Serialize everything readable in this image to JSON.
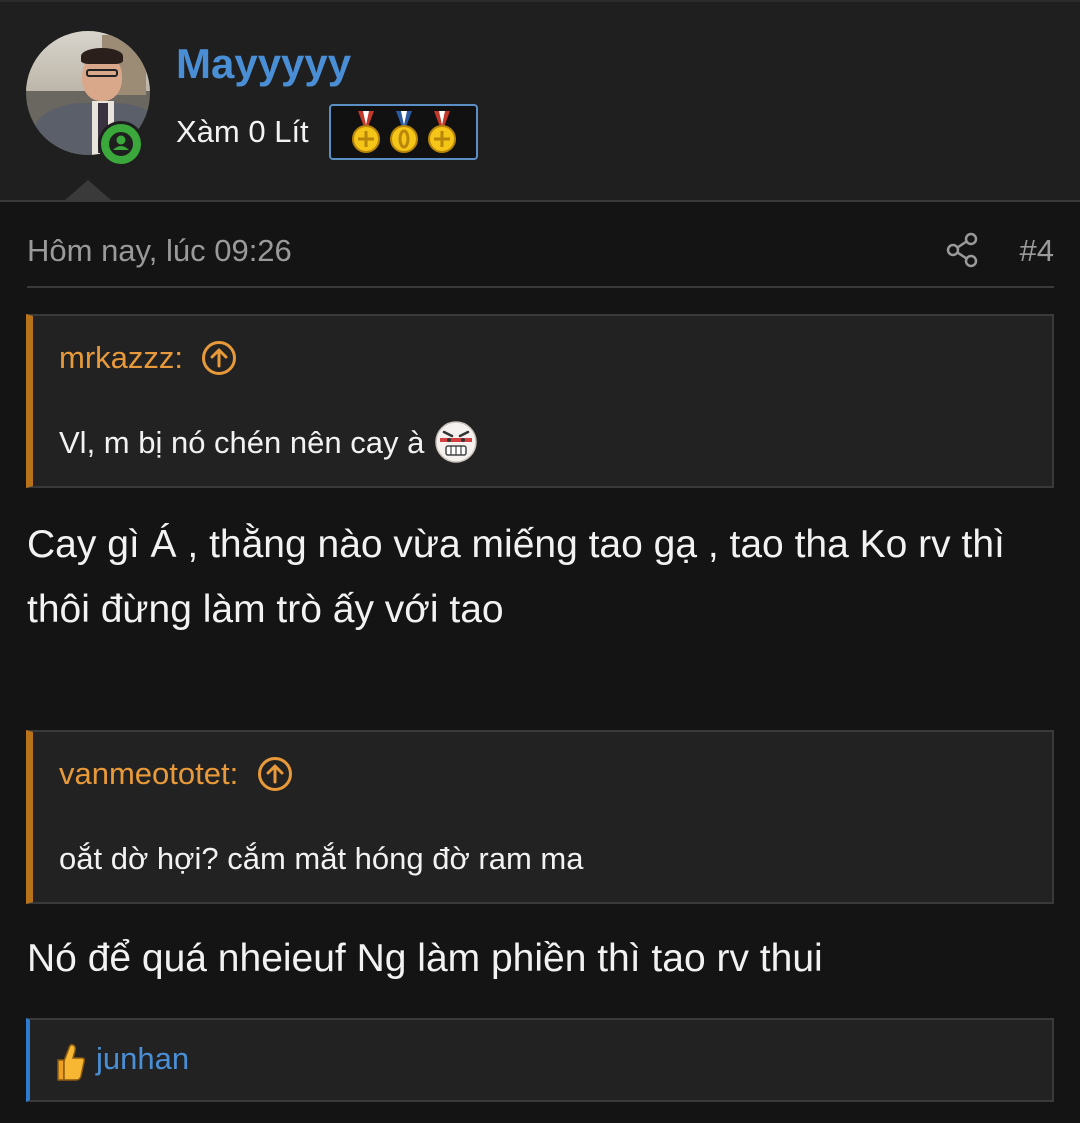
{
  "user": {
    "username": "Mayyyyy",
    "title": "Xàm 0 Lít",
    "status": "online",
    "medal_count": 3
  },
  "post": {
    "date": "Hôm nay, lúc 09:26",
    "number": "#4",
    "blocks": [
      {
        "type": "quote",
        "author": "mrkazzz:",
        "text": "Vl, m bị nó chén nên cay à",
        "emoji": "angry-face-emoji"
      },
      {
        "type": "text",
        "text": "Cay gì Á , thằng nào vừa miếng tao gạ , tao tha Ko rv thì thôi đừng làm trò ấy với tao"
      },
      {
        "type": "quote",
        "author": "vanmeototet:",
        "text": "oắt dờ hợi? cắm mắt hóng đờ ram ma"
      },
      {
        "type": "text",
        "text": "Nó để quá nheieuf Ng làm phiền thì tao rv thui"
      }
    ],
    "reactions": {
      "icon": "thumbs-up-icon",
      "users": "junhan"
    }
  },
  "colors": {
    "background": "#141414",
    "header_bg": "#1f1f1f",
    "username": "#4a8fd6",
    "quote_accent": "#b8731a",
    "quote_author": "#e89a3a",
    "reaction_accent": "#2e7bd1",
    "muted_text": "#9a9a9a",
    "online": "#3aa83a"
  }
}
